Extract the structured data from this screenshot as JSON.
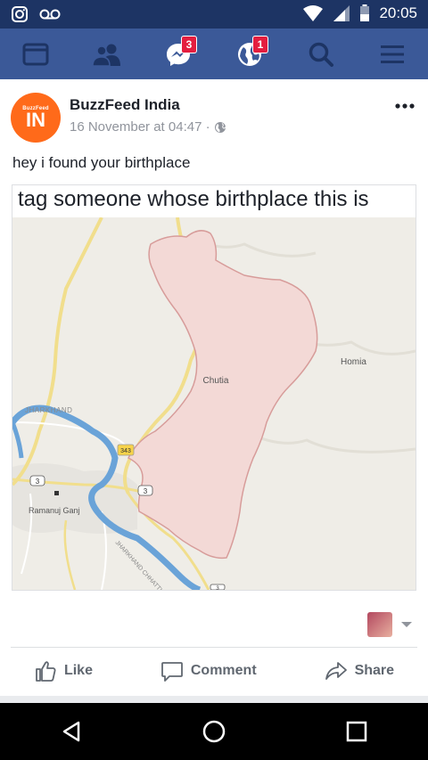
{
  "status_bar": {
    "time": "20:05",
    "icons": [
      "instagram-icon",
      "voicemail-icon",
      "wifi-icon",
      "signal-icon",
      "battery-icon"
    ]
  },
  "nav": {
    "items": [
      {
        "name": "news-feed",
        "icon": "newsfeed-icon"
      },
      {
        "name": "friends",
        "icon": "friends-icon"
      },
      {
        "name": "messenger",
        "icon": "messenger-icon",
        "badge": "3"
      },
      {
        "name": "notifications",
        "icon": "globe-icon",
        "badge": "1"
      },
      {
        "name": "search",
        "icon": "search-icon"
      },
      {
        "name": "menu",
        "icon": "hamburger-icon"
      }
    ]
  },
  "post": {
    "avatar_small": "BuzzFeed",
    "avatar_big": "IN",
    "page_name": "BuzzFeed India",
    "timestamp": "16 November at 04:47 ·",
    "privacy_icon": "globe-icon",
    "text": "hey i found your birthplace",
    "meme_caption": "tag someone whose birthplace this is",
    "map_labels": {
      "chutia": "Chutia",
      "homia": "Homia",
      "jharkhand": "JHARKHAND",
      "ramanuj": "Ramanuj Ganj",
      "road343": "343",
      "road3a": "3",
      "road3b": "3",
      "road3c": "3",
      "border": "JHARKHAND CHHATTISGARH"
    }
  },
  "actions": {
    "like": "Like",
    "comment": "Comment",
    "share": "Share"
  },
  "colors": {
    "fb_blue": "#3b5998",
    "status_bar": "#1d3464",
    "badge_red": "#e41e3f",
    "buzzfeed_orange": "#ff6a1a",
    "map_region": "#f3d9d6",
    "river": "#6aa3d8"
  }
}
